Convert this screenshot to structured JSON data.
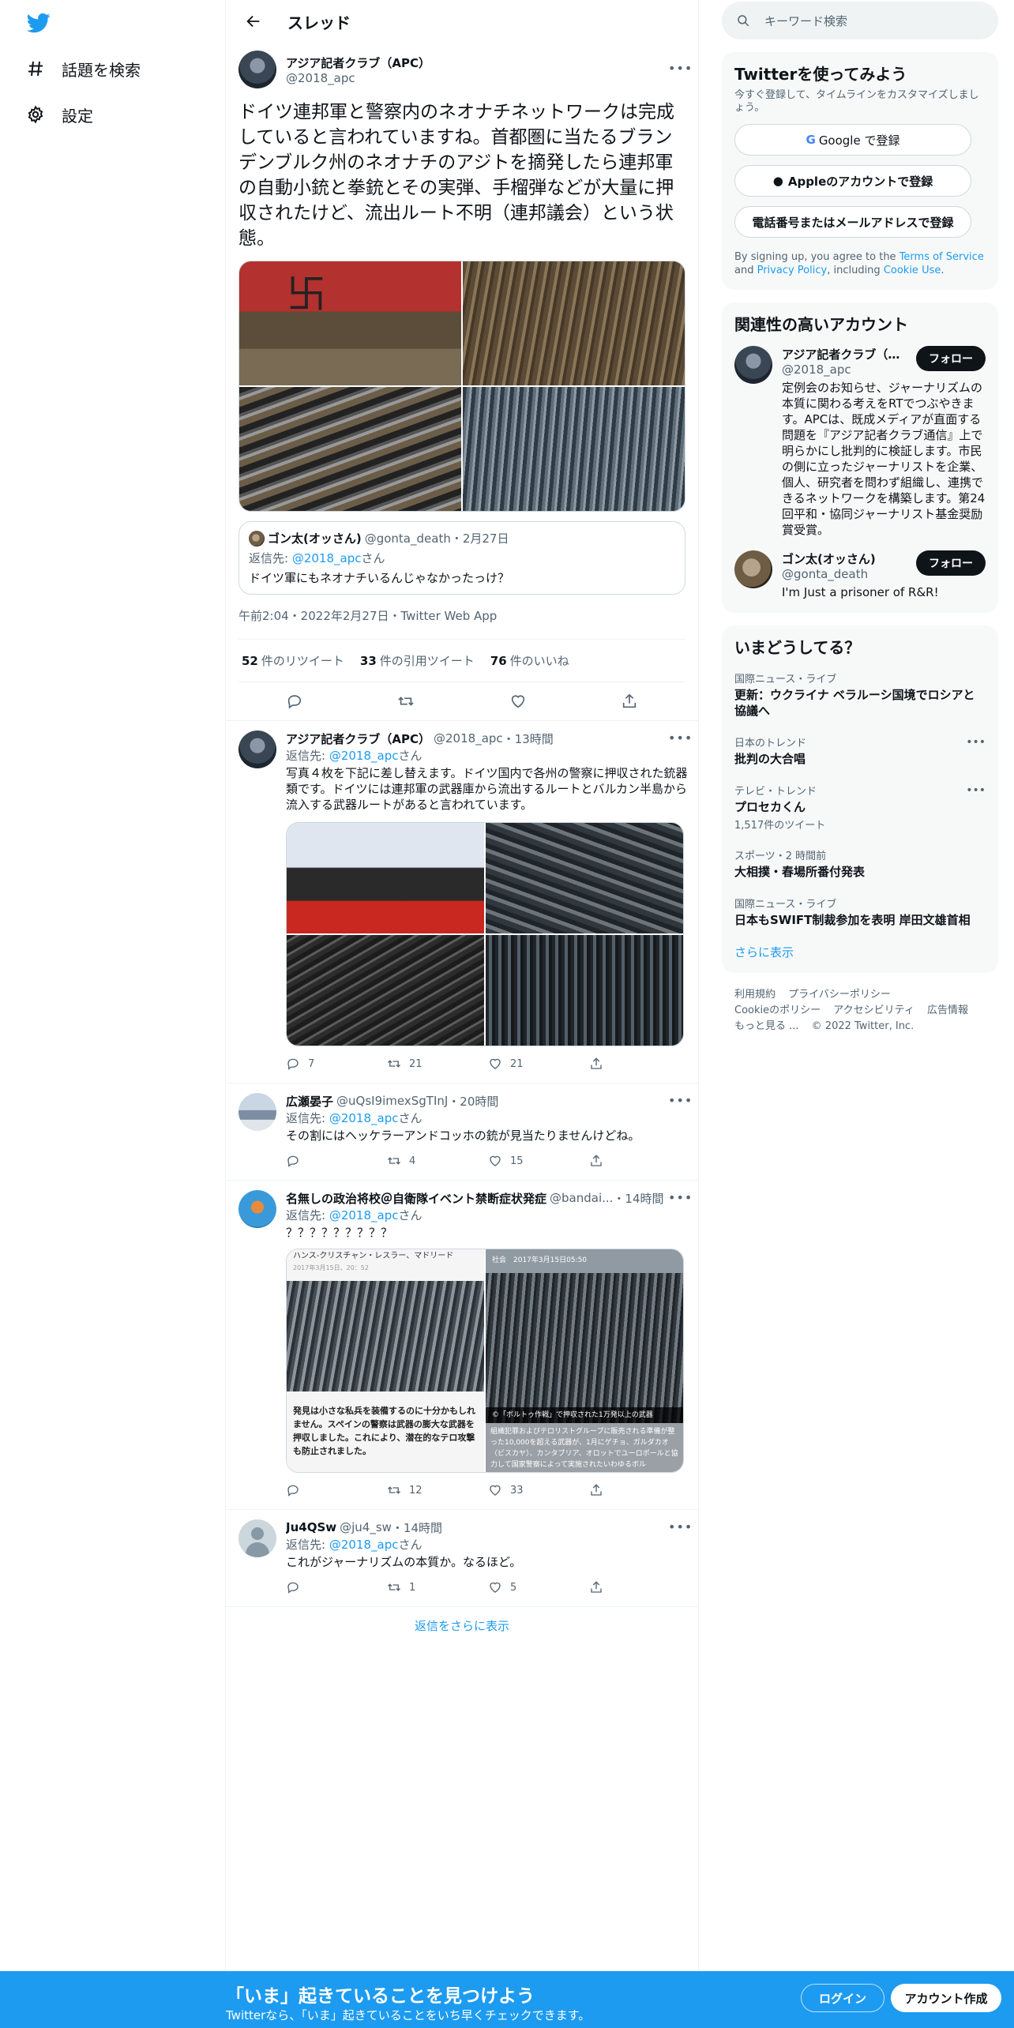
{
  "nav": {
    "items": [
      {
        "label": "話題を検索"
      },
      {
        "label": "設定"
      }
    ]
  },
  "header": {
    "title": "スレッド"
  },
  "focal": {
    "name": "アジア記者クラブ（APC）",
    "handle": "@2018_apc",
    "text": "ドイツ連邦軍と警察内のネオナチネットワークは完成していると言われていますね。首都圏に当たるブランデンブルク州のネオナチのアジトを摘発したら連邦軍の自動小銃と拳銃とその実弾、手榴弾などが大量に押収されたけど、流出ルート不明（連邦議会）という状態。",
    "quote": {
      "name": "ゴン太(オッさん)",
      "handle": "@gonta_death",
      "date": "2月27日",
      "reply_to_prefix": "返信先: ",
      "reply_to": "@2018_apc",
      "reply_to_suffix": "さん",
      "text": "ドイツ軍にもネオナチいるんじゃなかったっけ？"
    },
    "meta": "午前2:04・2022年2月27日・Twitter Web App",
    "stats": [
      {
        "count": "52",
        "label": "件のリツイート"
      },
      {
        "count": "33",
        "label": "件の引用ツイート"
      },
      {
        "count": "76",
        "label": "件のいいね"
      }
    ]
  },
  "replies": [
    {
      "name": "アジア記者クラブ（APC）",
      "handle": "@2018_apc",
      "time": "・13時間",
      "reply_prefix": "返信先: ",
      "reply_to": "@2018_apc",
      "reply_suffix": "さん",
      "text": "写真４枚を下記に差し替えます。ドイツ国内で各州の警察に押収された銃器類です。ドイツには連邦軍の武器庫から流出するルートとバルカン半島から流入する武器ルートがあると言われています。",
      "replies": "7",
      "retweets": "21",
      "likes": "21"
    },
    {
      "name": "広瀬晏子",
      "handle": "@uQsI9imexSgTInJ",
      "time": "・20時間",
      "reply_prefix": "返信先: ",
      "reply_to": "@2018_apc",
      "reply_suffix": "さん",
      "text": "その割にはヘッケラーアンドコッホの銃が見当たりませんけどね。",
      "replies": "",
      "retweets": "4",
      "likes": "15"
    },
    {
      "name": "名無しの政治将校＠自衛隊イベント禁断症状発症",
      "handle": "@bandai...",
      "time": "・14時間",
      "reply_prefix": "返信先: ",
      "reply_to": "@2018_apc",
      "reply_suffix": "さん",
      "text": "？？？？？？？？？",
      "shot1": {
        "caption": "ハンス-クリスチャン・レスラー、マドリード",
        "date": "2017年3月15日、20：52",
        "body": "発見は小さな私兵を装備するのに十分かもしれません。スペインの警察は武器の膨大な武器を押収しました。これにより、潜在的なテロ攻撃も防止されました。"
      },
      "shot2": {
        "topbar": "社会　2017年3月15日05:50",
        "band": "©「ボルトゥ作戦」で押収された1万発以上の武器",
        "body": "組織犯罪およびテロリストグループに販売される準備が整った10,000を超える武器が、1月にゲチョ、ガルダカオ（ビスカヤ）、カンタブリア、オロットでユーロポールと協力して国家警察によって実施されたいわゆるボル"
      },
      "replies": "",
      "retweets": "12",
      "likes": "33"
    },
    {
      "name": "Ju4QSw",
      "handle": "@ju4_sw",
      "time": "・14時間",
      "reply_prefix": "返信先: ",
      "reply_to": "@2018_apc",
      "reply_suffix": "さん",
      "text": "これがジャーナリズムの本質か。なるほど。",
      "replies": "",
      "retweets": "1",
      "likes": "5"
    }
  ],
  "show_more": "返信をさらに表示",
  "right": {
    "search_placeholder": "キーワード検索",
    "signup": {
      "title": "Twitterを使ってみよう",
      "subtitle": "今すぐ登録して、タイムラインをカスタマイズしましょう。",
      "google": "Google で登録",
      "apple": "Appleのアカウントで登録",
      "phone": "電話番号またはメールアドレスで登録",
      "terms_prefix": "By signing up, you agree to the ",
      "terms_link": "Terms of Service",
      "terms_and": " and ",
      "privacy_link": "Privacy Policy",
      "terms_including": ", including ",
      "cookie_link": "Cookie Use",
      "terms_end": "."
    },
    "related": {
      "title": "関連性の高いアカウント",
      "accounts": [
        {
          "name": "アジア記者クラブ（APC）",
          "handle": "@2018_apc",
          "follow": "フォロー",
          "bio": "定例会のお知らせ、ジャーナリズムの本質に関わる考えをRTでつぶやきます。APCは、既成メディアが直面する問題を『アジア記者クラブ通信』上で明らかにし批判的に検証します。市民の側に立ったジャーナリストを企業、個人、研究者を問わず組織し、連携できるネットワークを構築します。第24回平和・協同ジャーナリスト基金奨励賞受賞。"
        },
        {
          "name": "ゴン太(オッさん)",
          "handle": "@gonta_death",
          "follow": "フォロー",
          "bio": "I'm Just a prisoner of R&R!"
        }
      ]
    },
    "trends": {
      "title": "いまどうしてる？",
      "items": [
        {
          "context": "国際ニュース・ライブ",
          "title": "更新：ウクライナ ベラルーシ国境でロシアと協議へ",
          "count": "",
          "more": false
        },
        {
          "context": "日本のトレンド",
          "title": "批判の大合唱",
          "count": "",
          "more": true
        },
        {
          "context": "テレビ・トレンド",
          "title": "プロセカくん",
          "count": "1,517件のツイート",
          "more": true
        },
        {
          "context": "スポーツ・2 時間前",
          "title": "大相撲・春場所番付発表",
          "count": "",
          "more": false
        },
        {
          "context": "国際ニュース・ライブ",
          "title": "日本もSWIFT制裁参加を表明 岸田文雄首相",
          "count": "",
          "more": false
        }
      ],
      "show_more": "さらに表示"
    },
    "footer": {
      "links": [
        "利用規約",
        "プライバシーポリシー",
        "Cookieのポリシー",
        "アクセシビリティ",
        "広告情報",
        "もっと見る ..."
      ],
      "copyright": "© 2022 Twitter, Inc."
    }
  },
  "bottombar": {
    "title": "「いま」起きていることを見つけよう",
    "subtitle": "Twitterなら、「いま」起きていることをいち早くチェックできます。",
    "login": "ログイン",
    "signup": "アカウント作成"
  },
  "colors": {
    "accent": "#1d9bf0",
    "text": "#0f1419",
    "secondary": "#536471"
  }
}
